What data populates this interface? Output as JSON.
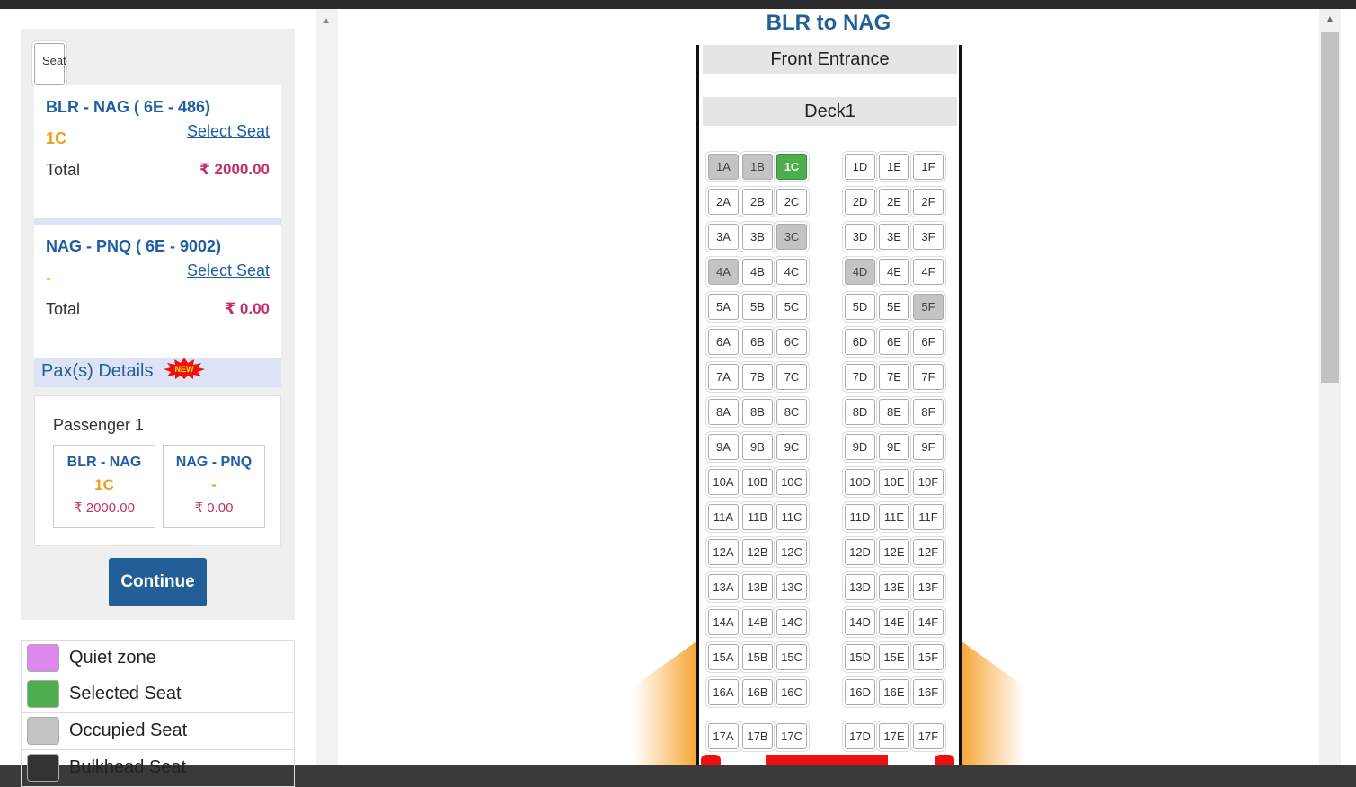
{
  "title": "BLR to NAG",
  "seat_details_header": "Seat Details",
  "segments": [
    {
      "route": "BLR - NAG ( 6E - 486)",
      "seat": "1C",
      "select_label": "Select Seat",
      "total_label": "Total",
      "amount": "₹ 2000.00"
    },
    {
      "route": "NAG - PNQ ( 6E - 9002)",
      "seat": "-",
      "select_label": "Select Seat",
      "total_label": "Total",
      "amount": "₹ 0.00"
    }
  ],
  "pax_header": "Pax(s) Details",
  "new_badge": "NEW",
  "passenger": {
    "name": "Passenger 1",
    "legs": [
      {
        "route": "BLR - NAG",
        "seat": "1C",
        "amount": "₹ 2000.00"
      },
      {
        "route": "NAG - PNQ",
        "seat": "-",
        "amount": "₹ 0.00"
      }
    ]
  },
  "continue_label": "Continue",
  "legend": [
    {
      "label": "Quiet zone",
      "color": "#dd88ee"
    },
    {
      "label": "Selected Seat",
      "color": "#4cae4c"
    },
    {
      "label": "Occupied Seat",
      "color": "#c4c4c4"
    },
    {
      "label": "Bulkhead Seat",
      "color": "#333333"
    }
  ],
  "seatmap": {
    "front_label": "Front Entrance",
    "deck_label": "Deck1",
    "rows": 17,
    "left_cols": [
      "A",
      "B",
      "C"
    ],
    "right_cols": [
      "D",
      "E",
      "F"
    ],
    "occupied": [
      "1A",
      "1B",
      "3C",
      "4A",
      "4D",
      "5F"
    ],
    "selected": [
      "1C"
    ]
  },
  "colors": {
    "accent": "#225f96",
    "price": "#c0306a",
    "seat_code": "#f0a020",
    "exit": "#ee1111",
    "wing": "#f7a637"
  }
}
